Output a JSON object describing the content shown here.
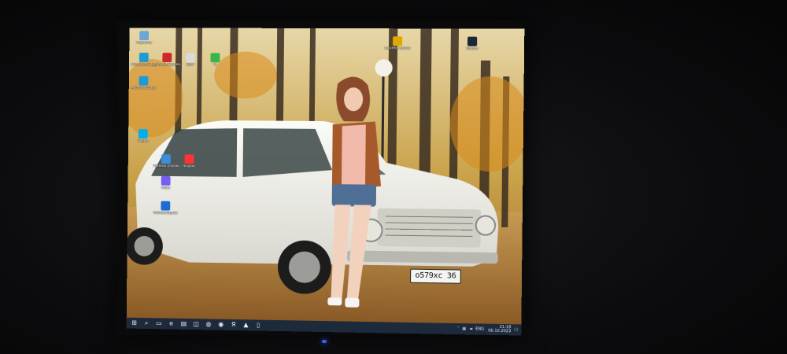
{
  "scene": {
    "description_colors": {
      "bezel": "#0a0a0b",
      "led": "#3b5bff",
      "taskbar": "#1d2a3c"
    }
  },
  "desktop": {
    "icons": [
      {
        "label": "Корзина",
        "icon": "recycle-bin-icon",
        "color": "#6aa6d8"
      },
      {
        "label": "Microsoft Edge",
        "icon": "edge-icon",
        "color": "#1e9ad6"
      },
      {
        "label": "Acrobat Reader",
        "icon": "acrobat-icon",
        "color": "#d0262d"
      },
      {
        "label": "SWF",
        "icon": "swf-icon",
        "color": "#d9d9d9"
      },
      {
        "label": "Ti",
        "icon": "ti-icon",
        "color": "#39b54a"
      },
      {
        "label": "Microsoft Edge",
        "icon": "edge-icon",
        "color": "#1e9ad6"
      },
      {
        "label": "Панель управления",
        "icon": "control-panel-icon",
        "color": "#3b8fd9"
      },
      {
        "label": "Яндекс",
        "icon": "yandex-icon",
        "color": "#ff3333"
      },
      {
        "label": "Skype",
        "icon": "skype-icon",
        "color": "#00aff0"
      },
      {
        "label": "Viber",
        "icon": "viber-icon",
        "color": "#7360f2"
      },
      {
        "label": "Malwarebytes",
        "icon": "malwarebytes-icon",
        "color": "#1b6cd1"
      },
      {
        "label": "Counter-Strike",
        "icon": "game-icon",
        "color": "#e0a800"
      },
      {
        "label": "Steam",
        "icon": "steam-icon",
        "color": "#1b2838"
      }
    ],
    "plate_text": "о579хс 36"
  },
  "taskbar": {
    "buttons": [
      {
        "icon": "start-icon",
        "glyph": "⊞"
      },
      {
        "icon": "search-icon",
        "glyph": "⌕"
      },
      {
        "icon": "task-view-icon",
        "glyph": "▭"
      },
      {
        "icon": "edge-icon",
        "glyph": "e"
      },
      {
        "icon": "explorer-icon",
        "glyph": "▤"
      },
      {
        "icon": "store-icon",
        "glyph": "◫"
      },
      {
        "icon": "chrome-icon",
        "glyph": "◍"
      },
      {
        "icon": "steam-icon",
        "glyph": "◉"
      },
      {
        "icon": "yandex-icon",
        "glyph": "Я"
      },
      {
        "icon": "acrobat-icon",
        "glyph": "▲"
      },
      {
        "icon": "document-icon",
        "glyph": "▯"
      }
    ],
    "tray": {
      "language": "ENG",
      "time": "21:18",
      "date": "06.10.2023"
    }
  }
}
